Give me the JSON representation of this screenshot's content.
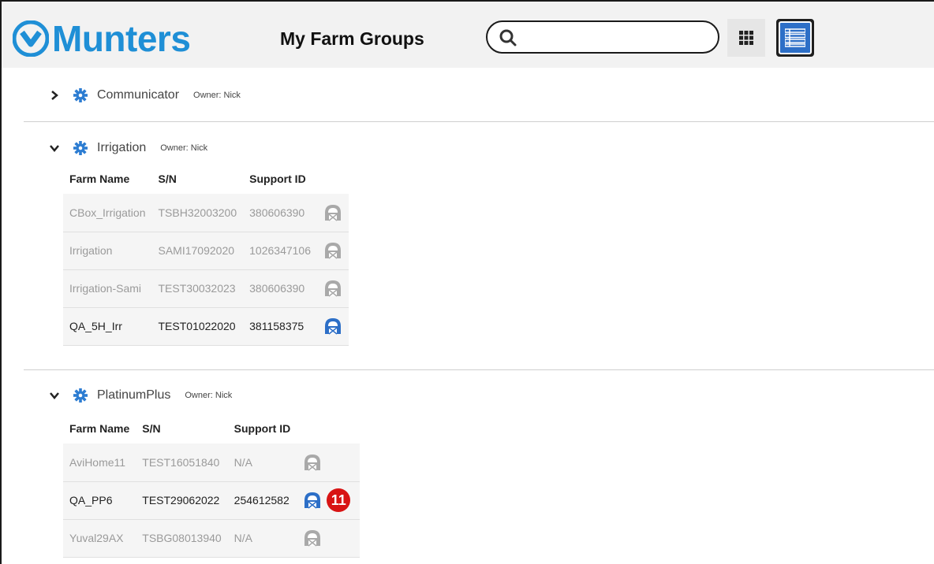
{
  "header": {
    "brand": "Munters",
    "title": "My Farm Groups",
    "search_placeholder": "",
    "colors": {
      "brand": "#1f8fd6",
      "active_view": "#2d6fc7"
    }
  },
  "columns": {
    "farm_name": "Farm Name",
    "sn": "S/N",
    "support_id": "Support ID"
  },
  "groups": [
    {
      "name": "Communicator",
      "owner": "Owner: Nick",
      "expanded": false,
      "farms": []
    },
    {
      "name": "Irrigation",
      "owner": "Owner: Nick",
      "expanded": true,
      "farms": [
        {
          "name": "CBox_Irrigation",
          "sn": "TSBH32003200",
          "support_id": "380606390",
          "online": false
        },
        {
          "name": "Irrigation",
          "sn": "SAMI17092020",
          "support_id": "1026347106",
          "online": false
        },
        {
          "name": "Irrigation-Sami",
          "sn": "TEST30032023",
          "support_id": "380606390",
          "online": false
        },
        {
          "name": "QA_5H_Irr",
          "sn": "TEST01022020",
          "support_id": "381158375",
          "online": true
        }
      ]
    },
    {
      "name": "PlatinumPlus",
      "owner": "Owner: Nick",
      "expanded": true,
      "farms": [
        {
          "name": "AviHome11",
          "sn": "TEST16051840",
          "support_id": "N/A",
          "online": false
        },
        {
          "name": "QA_PP6",
          "sn": "TEST29062022",
          "support_id": "254612582",
          "online": true,
          "badge": "11"
        },
        {
          "name": "Yuval29AX",
          "sn": "TSBG08013940",
          "support_id": "N/A",
          "online": false
        }
      ]
    }
  ],
  "icons": {
    "chevron_collapsed": "chevron-right-icon",
    "chevron_expanded": "chevron-down-icon",
    "settings": "gear-icon",
    "farm": "barn-icon"
  }
}
